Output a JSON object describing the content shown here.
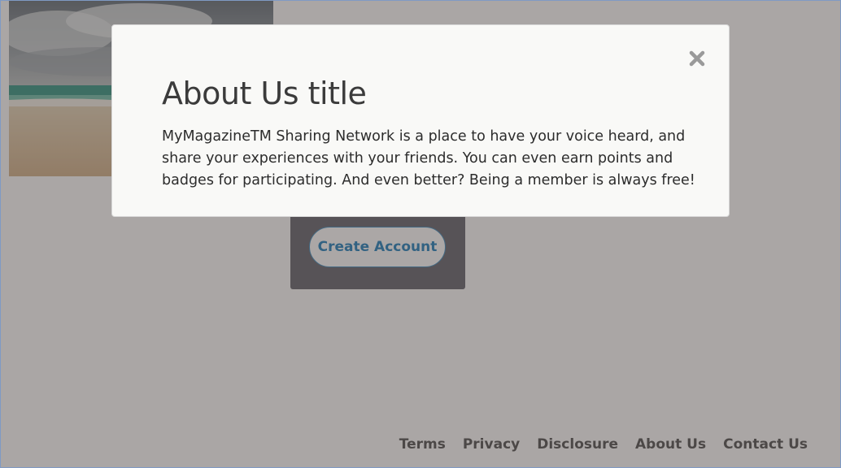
{
  "colors": {
    "overlay": "#8a8685",
    "modal_background": "#f9f9f7",
    "accent": "#1b78b4",
    "panel_background": "#2e2e32"
  },
  "background": {
    "hero_image": "beach-ocean-clouds-photo",
    "signup_panel": {
      "create_account_label": "Create Account"
    }
  },
  "footer": {
    "links": [
      "Terms",
      "Privacy",
      "Disclosure",
      "About Us",
      "Contact Us"
    ]
  },
  "modal": {
    "close_icon": "close-x-icon",
    "title": "About Us title",
    "body": "MyMagazineTM Sharing Network is a place to have your voice heard, and share your experiences with your friends. You can even earn points and badges for participating. And even better? Being a member is always free!"
  }
}
